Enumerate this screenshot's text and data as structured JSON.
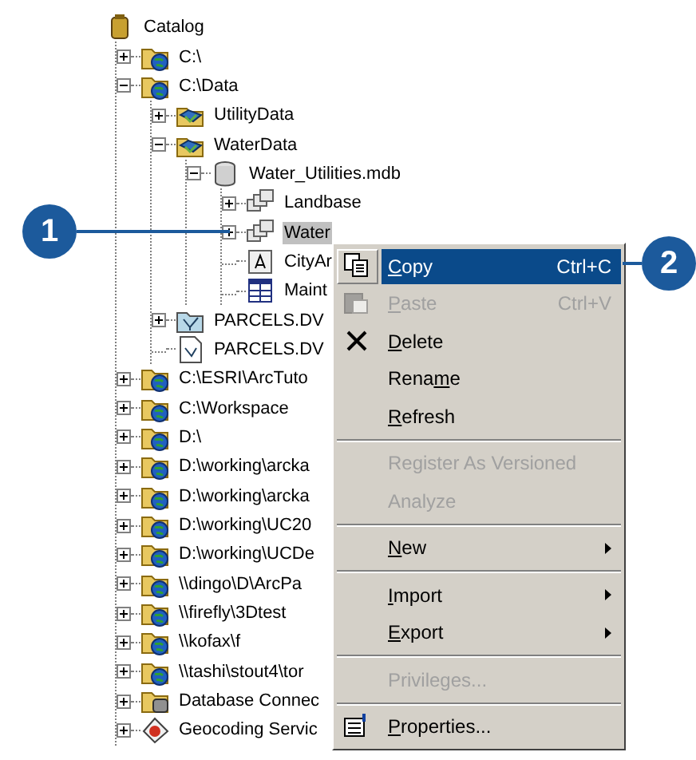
{
  "tree": {
    "label": "Catalog",
    "kind": "catalog",
    "children": [
      {
        "label": "C:\\",
        "kind": "folder-connection",
        "expanded": false,
        "selected": false
      },
      {
        "label": "C:\\Data",
        "kind": "folder-connection",
        "expanded": true,
        "selected": false,
        "children": [
          {
            "label": "UtilityData",
            "kind": "feature-dataset",
            "expanded": false,
            "selected": false
          },
          {
            "label": "WaterData",
            "kind": "feature-dataset",
            "expanded": true,
            "selected": false,
            "children": [
              {
                "label": "Water_Utilities.mdb",
                "kind": "database",
                "expanded": true,
                "selected": false,
                "children": [
                  {
                    "label": "Landbase",
                    "kind": "geo-dataset",
                    "expanded": false,
                    "selected": false
                  },
                  {
                    "label": "Water",
                    "kind": "geo-dataset",
                    "expanded": false,
                    "selected": true
                  },
                  {
                    "label": "CityAr",
                    "kind": "annotation",
                    "selected": false
                  },
                  {
                    "label": "Maint",
                    "kind": "table",
                    "selected": false
                  }
                ]
              }
            ]
          },
          {
            "label": "PARCELS.DV",
            "kind": "coverage",
            "expanded": false,
            "selected": false
          },
          {
            "label": "PARCELS.DV",
            "kind": "shapefile",
            "selected": false
          }
        ]
      },
      {
        "label": "C:\\ESRI\\ArcTuto",
        "kind": "folder-connection",
        "expanded": false,
        "selected": false
      },
      {
        "label": "C:\\Workspace",
        "kind": "folder-connection",
        "expanded": false,
        "selected": false
      },
      {
        "label": "D:\\",
        "kind": "folder-connection",
        "expanded": false,
        "selected": false
      },
      {
        "label": "D:\\working\\arcka",
        "kind": "folder-connection",
        "expanded": false,
        "selected": false
      },
      {
        "label": "D:\\working\\arcka",
        "kind": "folder-connection",
        "expanded": false,
        "selected": false
      },
      {
        "label": "D:\\working\\UC20",
        "kind": "folder-connection",
        "expanded": false,
        "selected": false
      },
      {
        "label": "D:\\working\\UCDe",
        "kind": "folder-connection",
        "expanded": false,
        "selected": false
      },
      {
        "label": "\\\\dingo\\D\\ArcPa",
        "kind": "folder-connection",
        "expanded": false,
        "selected": false
      },
      {
        "label": "\\\\firefly\\3Dtest",
        "kind": "folder-connection",
        "expanded": false,
        "selected": false
      },
      {
        "label": "\\\\kofax\\f",
        "kind": "folder-connection",
        "expanded": false,
        "selected": false
      },
      {
        "label": "\\\\tashi\\stout4\\tor",
        "kind": "folder-connection",
        "expanded": false,
        "selected": false
      },
      {
        "label": "Database Connec",
        "kind": "db-connection",
        "expanded": false,
        "selected": false
      },
      {
        "label": "Geocoding Servic",
        "kind": "geocoding",
        "expanded": false,
        "selected": false
      }
    ]
  },
  "context_menu": [
    {
      "kind": "copy",
      "access_key": "C",
      "label_after": "opy",
      "shortcut": "Ctrl+C",
      "disabled": false,
      "selected": true
    },
    {
      "kind": "paste",
      "access_key": "P",
      "label_after": "aste",
      "shortcut": "Ctrl+V",
      "disabled": true,
      "selected": false
    },
    {
      "kind": "delete",
      "access_key": "D",
      "label_after": "elete",
      "disabled": false,
      "selected": false
    },
    {
      "kind": "item",
      "label_before": "Rena",
      "access_key": "m",
      "label_after": "e",
      "disabled": false,
      "selected": false
    },
    {
      "kind": "item",
      "access_key": "R",
      "label_after": "efresh",
      "disabled": false,
      "selected": false
    },
    {
      "kind": "separator"
    },
    {
      "kind": "item",
      "label_before": "Register As Versioned",
      "disabled": true,
      "selected": false
    },
    {
      "kind": "item",
      "label_before": "Analyze",
      "disabled": true,
      "selected": false
    },
    {
      "kind": "separator"
    },
    {
      "kind": "item",
      "access_key": "N",
      "label_after": "ew",
      "submenu": true,
      "disabled": false,
      "selected": false
    },
    {
      "kind": "separator"
    },
    {
      "kind": "item",
      "access_key": "I",
      "label_after": "mport",
      "submenu": true,
      "disabled": false,
      "selected": false
    },
    {
      "kind": "item",
      "access_key": "E",
      "label_after": "xport",
      "submenu": true,
      "disabled": false,
      "selected": false
    },
    {
      "kind": "separator"
    },
    {
      "kind": "item",
      "label_before": "Privileges...",
      "disabled": true,
      "selected": false
    },
    {
      "kind": "separator"
    },
    {
      "kind": "properties",
      "access_key": "P",
      "label_after": "roperties...",
      "disabled": false,
      "selected": false
    }
  ],
  "callouts": [
    {
      "number": "1"
    },
    {
      "number": "2"
    }
  ]
}
